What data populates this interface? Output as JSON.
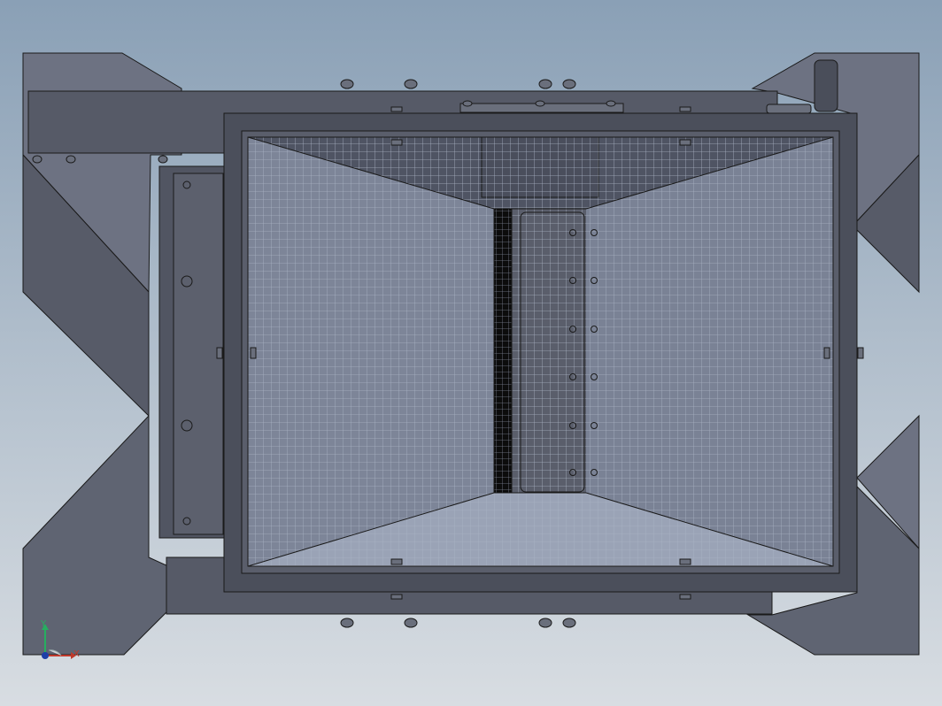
{
  "view": {
    "background_top": "#8aa0b6",
    "background_bottom": "#d8dde2"
  },
  "model": {
    "body_color": "#5a5f6c",
    "frame_color": "#4a4e5a",
    "mesh_color": "#8c95a8",
    "mesh_line_color": "#b8c0d0",
    "dark_slot_color": "#111111",
    "edge_color": "#1a1a1a"
  },
  "triad": {
    "x_label": "X",
    "y_label": "Y",
    "x_color": "#c0392b",
    "y_color": "#27ae60",
    "z_color": "#1f3fa8"
  }
}
